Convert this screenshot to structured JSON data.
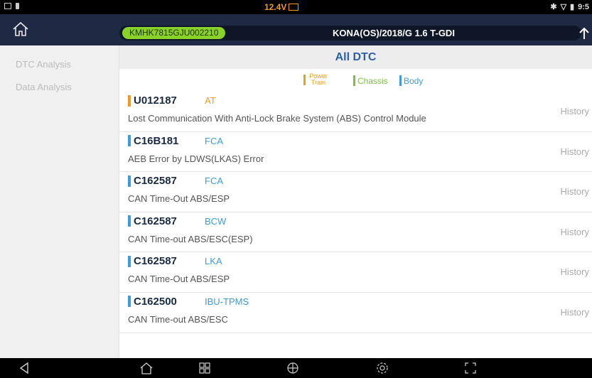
{
  "status_bar": {
    "voltage": "12.4V",
    "time": "9:5"
  },
  "header": {
    "vin": "KMHK7815GJU002210",
    "vehicle": "KONA(OS)/2018/G 1.6 T-GDI"
  },
  "sidebar": {
    "items": [
      {
        "label": "DTC Analysis"
      },
      {
        "label": "Data Analysis"
      }
    ]
  },
  "main": {
    "title": "All DTC",
    "legend": {
      "powertrain": "Power Train",
      "chassis": "Chassis",
      "body": "Body"
    },
    "dtcs": [
      {
        "code": "U012187",
        "module": "AT",
        "category": "powertrain",
        "description": "Lost Communication With Anti-Lock Brake System (ABS) Control Module",
        "status": "History"
      },
      {
        "code": "C16B181",
        "module": "FCA",
        "category": "body",
        "description": "AEB Error by LDWS(LKAS) Error",
        "status": "History"
      },
      {
        "code": "C162587",
        "module": "FCA",
        "category": "body",
        "description": "CAN Time-Out ABS/ESP",
        "status": "History"
      },
      {
        "code": "C162587",
        "module": "BCW",
        "category": "body",
        "description": "CAN Time-out ABS/ESC(ESP)",
        "status": "History"
      },
      {
        "code": "C162587",
        "module": "LKA",
        "category": "body",
        "description": "CAN Time-Out ABS/ESP",
        "status": "History"
      },
      {
        "code": "C162500",
        "module": "IBU-TPMS",
        "category": "body",
        "description": "CAN Time-out ABS/ESC",
        "status": "History"
      }
    ]
  },
  "colors": {
    "powertrain": "#f39a1a",
    "chassis": "#7ac142",
    "body": "#3c9bd9",
    "header": "#1e2a44",
    "vin_badge": "#8ad128"
  },
  "icons": {
    "home": "home-icon",
    "export": "export-icon",
    "back": "back-icon",
    "nav_home": "nav-home-icon",
    "apps": "apps-icon",
    "browser": "globe-icon",
    "settings": "gear-icon",
    "screenshot": "screenshot-icon"
  }
}
